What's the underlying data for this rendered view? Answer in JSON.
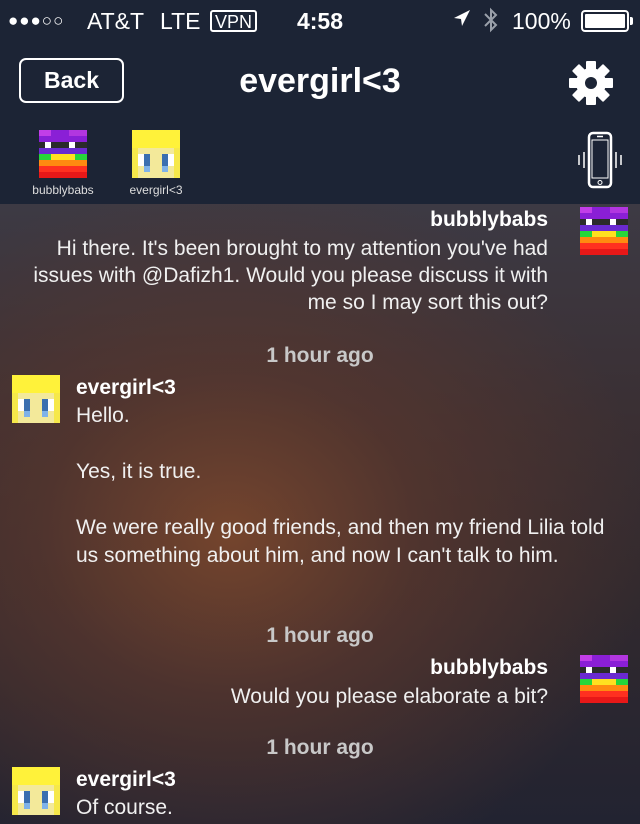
{
  "status_bar": {
    "signal": "●●●○○",
    "carrier": "AT&T",
    "network": "LTE",
    "vpn": "VPN",
    "time": "4:58",
    "battery": "100%"
  },
  "nav": {
    "back_label": "Back",
    "title": "evergirl<3"
  },
  "participants": [
    {
      "name": "bubblybabs"
    },
    {
      "name": "evergirl<3"
    }
  ],
  "messages": [
    {
      "sender": "bubblybabs",
      "text": "Hi there.  It's been brought to my attention you've had issues with @Dafizh1.  Would you please discuss it with me so I may sort this out?"
    },
    {
      "timestamp": "1 hour ago"
    },
    {
      "sender": "evergirl<3",
      "text": "Hello.\n\nYes, it is true.\n\nWe were really good friends, and then my friend Lilia told us something about him, and now I can't talk to him."
    },
    {
      "timestamp": "1 hour ago"
    },
    {
      "sender": "bubblybabs",
      "text": "Would you please elaborate a bit?"
    },
    {
      "timestamp": "1 hour ago"
    },
    {
      "sender": "evergirl<3",
      "text": "Of course."
    }
  ],
  "icons": {
    "location": "location-arrow-icon",
    "bluetooth": "bluetooth-icon",
    "settings": "gear-icon",
    "phone": "vibrating-phone-icon"
  }
}
